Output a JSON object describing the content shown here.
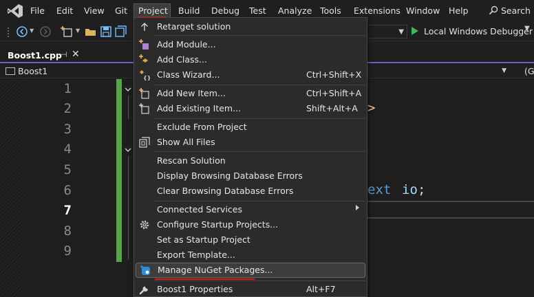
{
  "menubar": {
    "items": [
      "File",
      "Edit",
      "View",
      "Git",
      "Project",
      "Build",
      "Debug",
      "Test",
      "Analyze",
      "Tools",
      "Extensions",
      "Window",
      "Help"
    ],
    "search_label": "Search"
  },
  "toolbar": {
    "debug_target": "Local Windows Debugger"
  },
  "tab": {
    "title": "Boost1.cpp",
    "pin_glyph": "⊣",
    "close_glyph": "✕"
  },
  "navbar": {
    "scope": "Boost1",
    "right_fragment": "(G"
  },
  "editor": {
    "line_numbers": [
      "1",
      "2",
      "3",
      "4",
      "5",
      "6",
      "7",
      "8",
      "9"
    ],
    "current_line": "7",
    "visible_code": {
      "line2_fragment": ">",
      "line6_keyword_fragment": "ext",
      "line6_identifier": "io",
      "line6_punct": ";"
    }
  },
  "project_menu": {
    "items": [
      {
        "label": "Retarget solution",
        "shortcut": "",
        "icon": "up-arrow-icon"
      },
      {
        "label": "Add Module...",
        "shortcut": "",
        "icon": "add-module-icon"
      },
      {
        "label": "Add Class...",
        "shortcut": "",
        "icon": "add-class-icon"
      },
      {
        "label": "Class Wizard...",
        "shortcut": "Ctrl+Shift+X",
        "icon": "class-wizard-icon"
      },
      {
        "label": "Add New Item...",
        "shortcut": "Ctrl+Shift+A",
        "icon": "add-new-item-icon"
      },
      {
        "label": "Add Existing Item...",
        "shortcut": "Shift+Alt+A",
        "icon": "add-existing-item-icon"
      },
      {
        "label": "Exclude From Project",
        "shortcut": "",
        "icon": ""
      },
      {
        "label": "Show All Files",
        "shortcut": "",
        "icon": "show-all-files-icon"
      },
      {
        "label": "Rescan Solution",
        "shortcut": "",
        "icon": ""
      },
      {
        "label": "Display Browsing Database Errors",
        "shortcut": "",
        "icon": ""
      },
      {
        "label": "Clear Browsing Database Errors",
        "shortcut": "",
        "icon": ""
      },
      {
        "label": "Connected Services",
        "shortcut": "",
        "icon": ""
      },
      {
        "label": "Configure Startup Projects...",
        "shortcut": "",
        "icon": "gear-icon"
      },
      {
        "label": "Set as Startup Project",
        "shortcut": "",
        "icon": ""
      },
      {
        "label": "Export Template...",
        "shortcut": "",
        "icon": ""
      },
      {
        "label": "Manage NuGet Packages...",
        "shortcut": "",
        "icon": "nuget-icon"
      },
      {
        "label": "Boost1 Properties",
        "shortcut": "Alt+F7",
        "icon": "wrench-icon"
      }
    ]
  },
  "colors": {
    "annotation_red": "#e01b1b",
    "change_bar_green": "#57a64a",
    "tab_accent_purple": "#8f6bd8"
  }
}
